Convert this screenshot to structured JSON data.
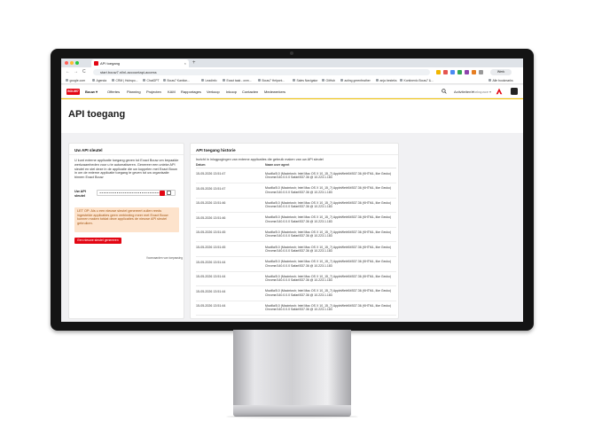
{
  "browser": {
    "tab_title": "API toegang",
    "tab_close": "×",
    "new_tab": "+",
    "url": "start.bouw7.nl/nl-accountapi-access",
    "back": "←",
    "forward": "→",
    "reload": "C",
    "profile": "Werk",
    "bookmarks": [
      "google.com",
      "Agenda",
      "CRM | Hubspo...",
      "ChatGPT",
      "Bouw7 Kantion...",
      "Leadinfo",
      "Exact taak - ovm...",
      "Bouw7 Helpcnt...",
      "Sales Navigator",
      "GitHub",
      "acting greenfeather",
      "anja besteks",
      "Kontinenlo Bouw7 &..."
    ],
    "bookmarks_extra": "Alle bookmarks",
    "colors": {
      "red": "#e30613",
      "yellow": "#f5c400"
    }
  },
  "app": {
    "logo": "BOUW7",
    "nav": [
      {
        "label": "Bouw ▾",
        "active": true
      },
      {
        "label": "Offertes"
      },
      {
        "label": "Planning"
      },
      {
        "label": "Projecten"
      },
      {
        "label": "KAM"
      },
      {
        "label": "Rapportages"
      },
      {
        "label": "Verkoop"
      },
      {
        "label": "Inkoop"
      },
      {
        "label": "Contacten"
      },
      {
        "label": "Medewerkers"
      }
    ],
    "activities": "Activiteiten ▾",
    "workspace": "Workspace ▾"
  },
  "page": {
    "title": "API toegang"
  },
  "api_key": {
    "card_title": "Uw API sleutel",
    "description": "U kunt externe applicatie toegang geven tot Exact Bouw om bepaalde werkzaamheden voor u te automatiseren. Genereer een unieke API sleutel en stel deze in de applicatie die uw koppelen met Exact Bouw in om de externe applicatie toegang te geven tot uw organisatie binnen Exact Bouw",
    "key_label": "Uw API sleutel",
    "key_value": "••••••••••••••••••••••••••••••••",
    "warning": "LET OP: Als u een nieuwe sleutel genereert zullen reeds ingestelde applicaties geen verbinding meer met Exact Bouw kunnen maken totdat deze applicaties de nieuwe API sleutel gebruiken.",
    "generate_button": "Een nieuwe sleutel genereren",
    "conditions_link": "Voorwaarden van toepassing"
  },
  "history": {
    "card_title": "API toegang historie",
    "intro": "Inzicht in inlogpogingen van externe applicaties die gebruik maken van uw API sleutel",
    "columns": [
      "Datum",
      "Naam user agent"
    ],
    "rows": [
      {
        "date": "15-05-2026 13:51:47",
        "agent": "Mozilla/5.0 (Macintosh; Intel Mac OS X 10_15_7) AppleWebKit/537.36 (KHTML, like Gecko) Chrome/140.0.0.0 Safari/537.36 @ 10.223.1.183"
      },
      {
        "date": "15-05-2026 13:51:47",
        "agent": "Mozilla/5.0 (Macintosh; Intel Mac OS X 10_15_7) AppleWebKit/537.36 (KHTML, like Gecko) Chrome/140.0.0.0 Safari/537.36 @ 10.223.1.183"
      },
      {
        "date": "15-05-2026 13:51:46",
        "agent": "Mozilla/5.0 (Macintosh; Intel Mac OS X 10_15_7) AppleWebKit/537.36 (KHTML, like Gecko) Chrome/140.0.0.0 Safari/537.36 @ 10.223.1.183"
      },
      {
        "date": "15-05-2026 13:51:46",
        "agent": "Mozilla/5.0 (Macintosh; Intel Mac OS X 10_15_7) AppleWebKit/537.36 (KHTML, like Gecko) Chrome/140.0.0.0 Safari/537.36 @ 10.223.1.183"
      },
      {
        "date": "15-05-2026 13:51:45",
        "agent": "Mozilla/5.0 (Macintosh; Intel Mac OS X 10_15_7) AppleWebKit/537.36 (KHTML, like Gecko) Chrome/140.0.0.0 Safari/537.36 @ 10.223.1.183"
      },
      {
        "date": "15-05-2026 13:51:45",
        "agent": "Mozilla/5.0 (Macintosh; Intel Mac OS X 10_15_7) AppleWebKit/537.36 (KHTML, like Gecko) Chrome/140.0.0.0 Safari/537.36 @ 10.223.1.183"
      },
      {
        "date": "15-05-2026 13:51:44",
        "agent": "Mozilla/5.0 (Macintosh; Intel Mac OS X 10_15_7) AppleWebKit/537.36 (KHTML, like Gecko) Chrome/140.0.0.0 Safari/537.36 @ 10.223.1.183"
      },
      {
        "date": "15-05-2026 13:51:44",
        "agent": "Mozilla/5.0 (Macintosh; Intel Mac OS X 10_15_7) AppleWebKit/537.36 (KHTML, like Gecko) Chrome/140.0.0.0 Safari/537.36 @ 10.223.1.183"
      },
      {
        "date": "15-05-2026 13:51:44",
        "agent": "Mozilla/5.0 (Macintosh; Intel Mac OS X 10_15_7) AppleWebKit/537.36 (KHTML, like Gecko) Chrome/140.0.0.0 Safari/537.36 @ 10.223.1.183"
      },
      {
        "date": "15-05-2026 13:51:44",
        "agent": "Mozilla/5.0 (Macintosh; Intel Mac OS X 10_15_7) AppleWebKit/537.36 (KHTML, like Gecko) Chrome/140.0.0.0 Safari/537.36 @ 10.223.1.183"
      }
    ]
  }
}
